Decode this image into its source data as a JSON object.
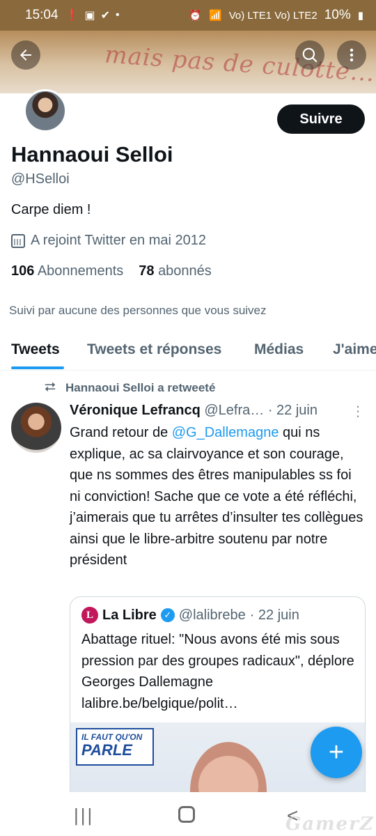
{
  "status_bar": {
    "time": "15:04",
    "signal_text": "Vo) LTE1 Vo) LTE2",
    "battery": "10%"
  },
  "banner": {
    "handwriting": "mais pas de culotte..."
  },
  "profile": {
    "name": "Hannaoui Selloi",
    "handle": "@HSelloi",
    "bio": "Carpe diem !",
    "joined": "A rejoint Twitter en mai 2012",
    "following_count": "106",
    "following_label": "Abonnements",
    "followers_count": "78",
    "followers_label": "abonnés",
    "followed_by": "Suivi par aucune des personnes que vous suivez",
    "follow_button": "Suivre"
  },
  "tabs": [
    {
      "label": "Tweets",
      "active": true
    },
    {
      "label": "Tweets et réponses",
      "active": false
    },
    {
      "label": "Médias",
      "active": false
    },
    {
      "label": "J'aime",
      "active": false
    }
  ],
  "tweet": {
    "retweet_label": "Hannaoui Selloi a retweeté",
    "author_name": "Véronique Lefrancq",
    "author_handle": "@Lefra…",
    "date": "· 22 juin",
    "text_before": "Grand retour de ",
    "mention": "@G_Dallemagne",
    "text_after": " qui ns explique, ac sa clairvoyance et son courage, que ns sommes des êtres manipulables ss foi ni conviction! Sache que ce vote a été réfléchi, j’aimerais que tu arrêtes d’insulter tes collègues ainsi que le libre-arbitre soutenu par notre président"
  },
  "quoted": {
    "logo": "L",
    "name": "La Libre",
    "handle": "@lalibrebe",
    "date": "· 22 juin",
    "text": "Abattage rituel: \"Nous avons été mis sous pression par des groupes radicaux\", déplore Georges Dallemagne lalibre.be/belgique/polit…",
    "media_badge_line1": "IL FAUT QU'ON",
    "media_badge_line2": "PARLE"
  },
  "fab_label": "+",
  "watermark": "GamerZ",
  "colors": {
    "accent": "#1d9bf0",
    "status_bar": "#8a6a3c",
    "text_primary": "#0f1419",
    "text_secondary": "#536471"
  }
}
